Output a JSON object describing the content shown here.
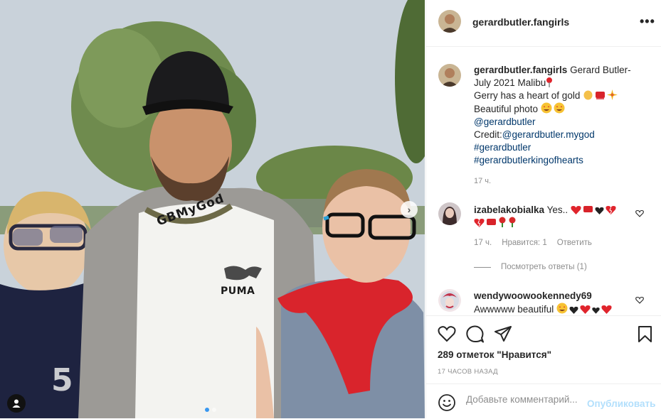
{
  "photo": {
    "watermark": "GBMyGod",
    "shirt_brand": "PUMA",
    "shirt_number": "5"
  },
  "header": {
    "username": "gerardbutler.fangirls",
    "more_icon": "•••"
  },
  "caption": {
    "username": "gerardbutler.fangirls",
    "text_line1": "Gerard Butler-July 2021 Malibu",
    "text_line2": "Gerry has a heart of gold",
    "text_line3": "Beautiful photo",
    "mention": "@gerardbutler",
    "credit_prefix": "Credit:",
    "credit_handle": "@gerardbutler.mygod",
    "hashtag1": "#gerardbutler",
    "hashtag2": "#gerardbutlerkingofhearts",
    "time": "17 ч."
  },
  "comments": [
    {
      "username": "izabelakobialka",
      "text": "Yes..",
      "time": "17 ч.",
      "likes": "Нравится: 1",
      "reply": "Ответить",
      "view_replies": "Посмотреть ответы (1)"
    },
    {
      "username": "wendywoowookennedy69",
      "text": "Awwwww beautiful"
    }
  ],
  "actions": {
    "likes_count": "289 отметок \"Нравится\"",
    "date": "17 ЧАСОВ НАЗАД"
  },
  "comment_bar": {
    "placeholder": "Добавьте комментарий...",
    "publish": "Опубликовать"
  },
  "colors": {
    "link": "#00376b",
    "publish_disabled": "#b2dffc",
    "muted": "#8e8e8e",
    "carousel_active": "#3897f0"
  }
}
